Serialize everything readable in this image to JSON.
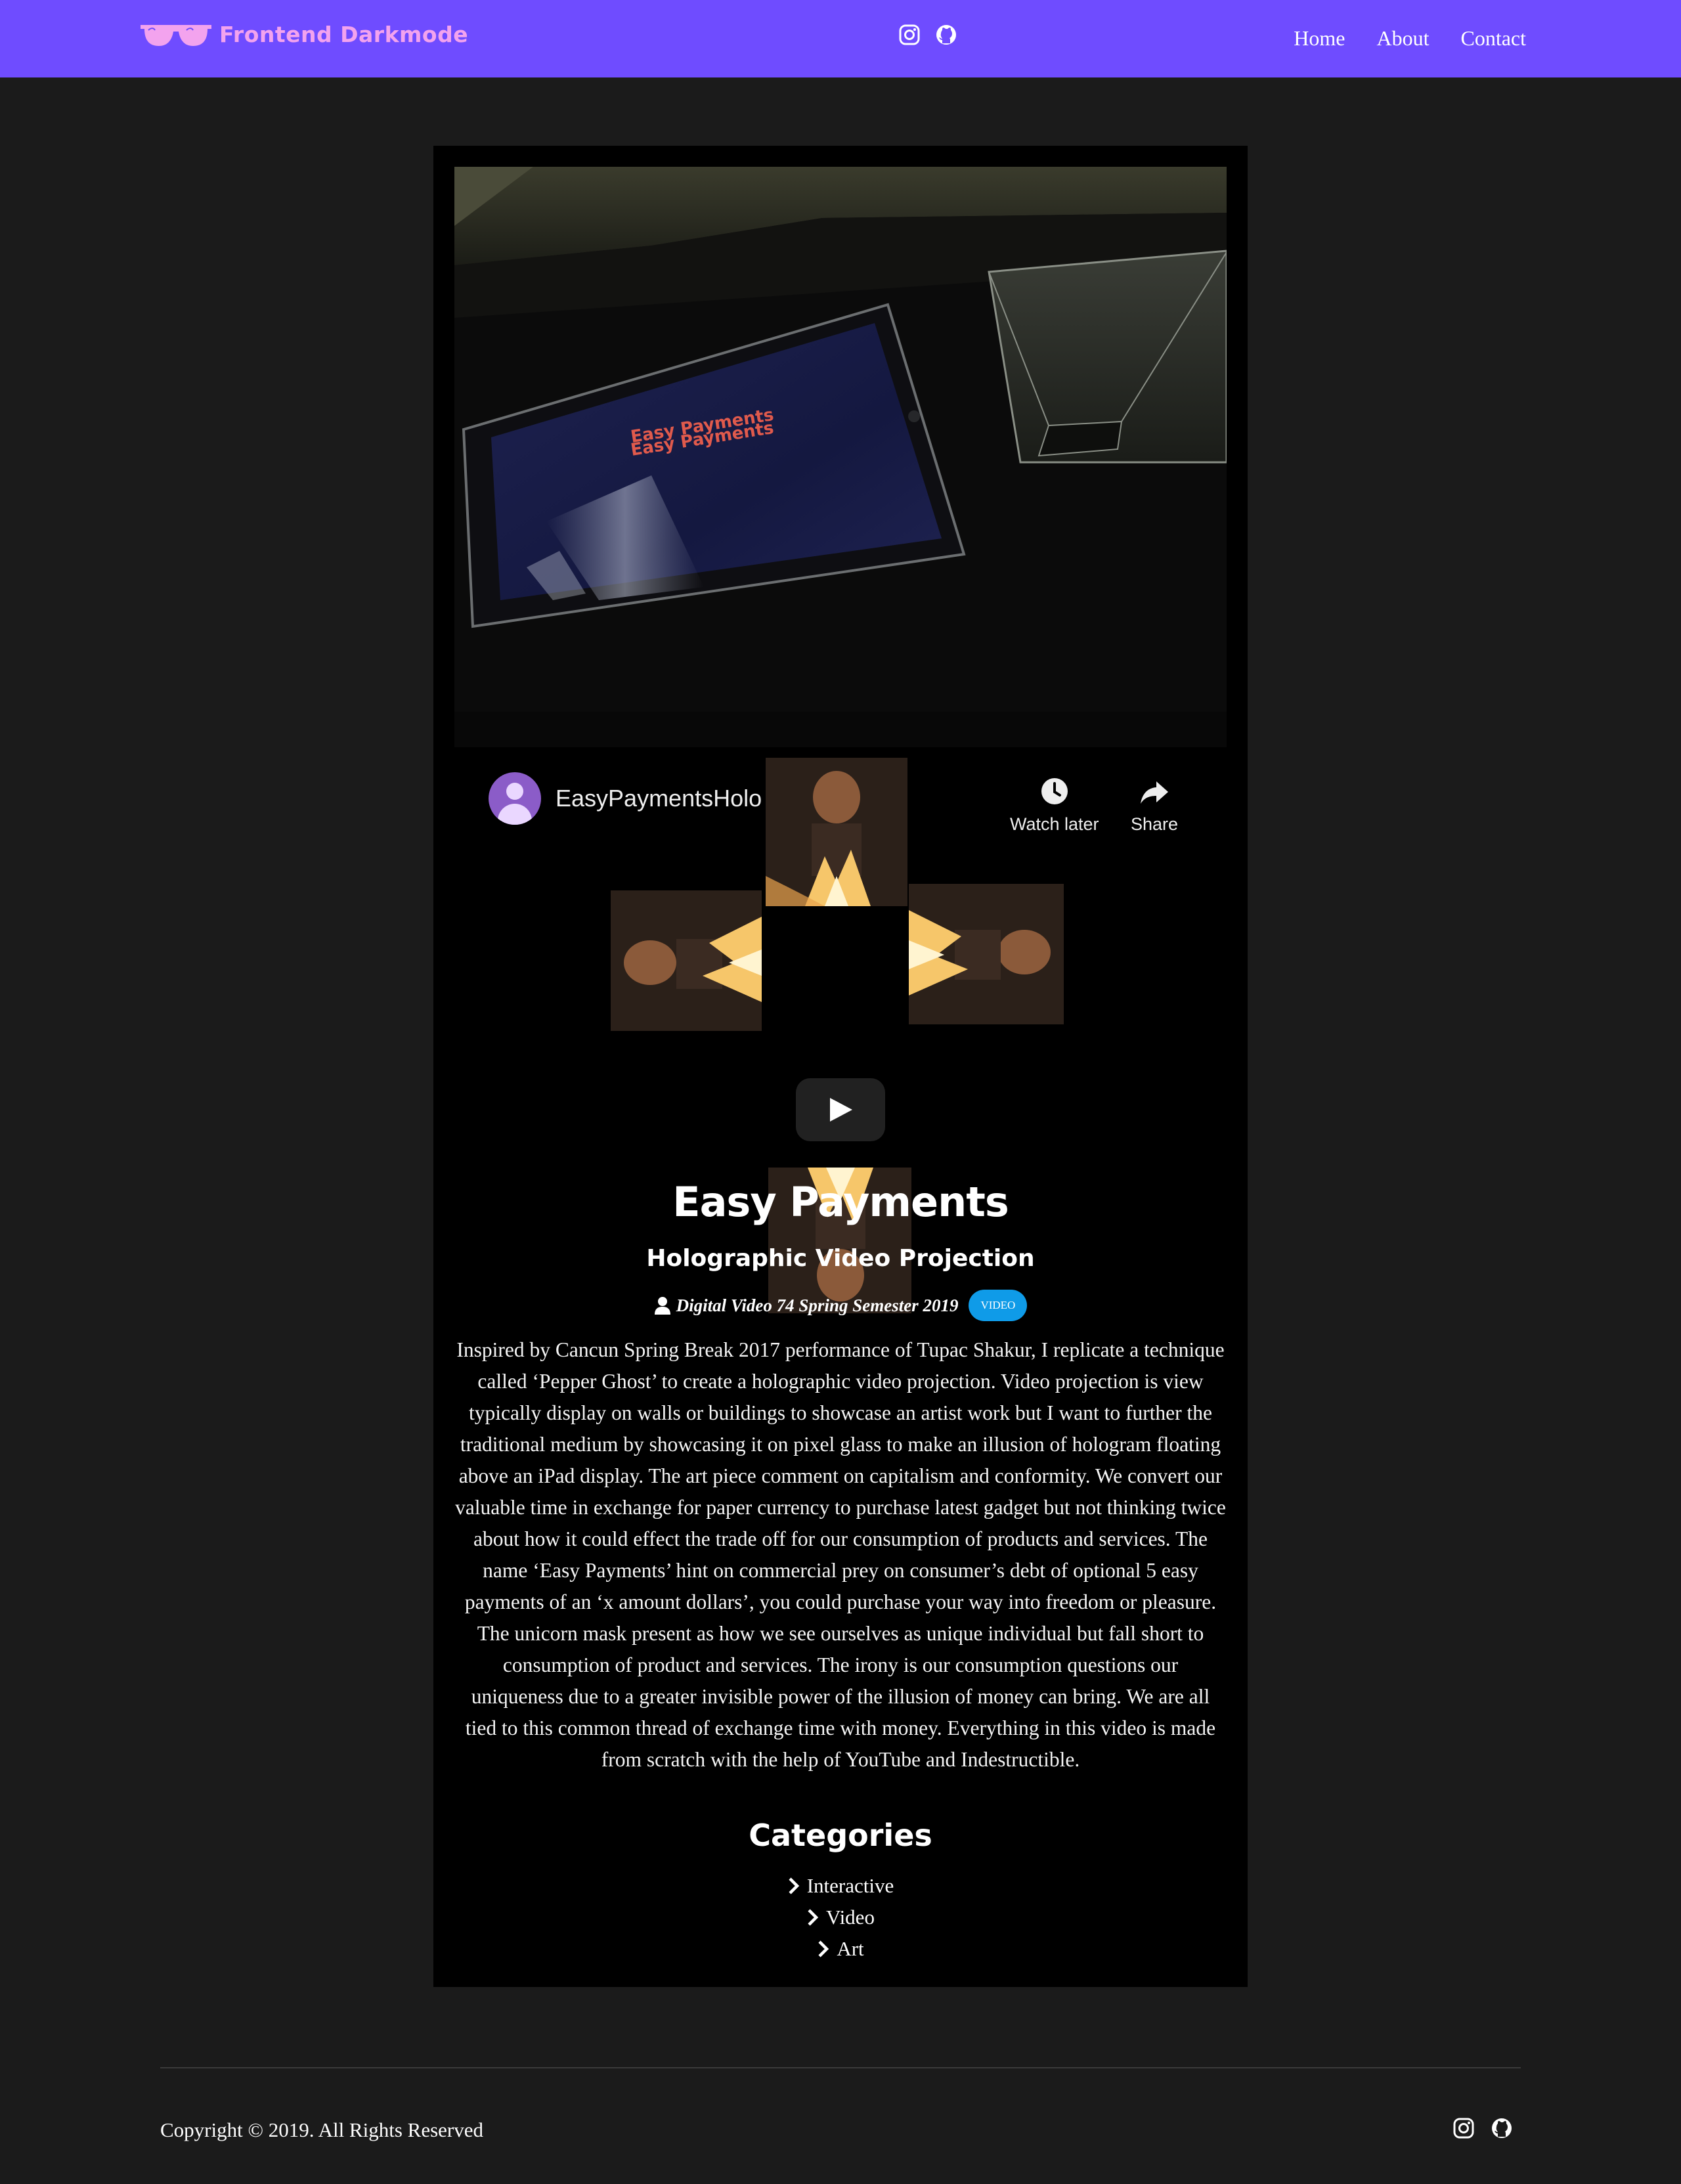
{
  "navbar": {
    "brand": "Frontend Darkmode",
    "brand_color": "#f3a3ee",
    "background": "#6f4cff",
    "social_icons": [
      "instagram-icon",
      "github-icon"
    ],
    "links": [
      "Home",
      "About",
      "Contact"
    ]
  },
  "video": {
    "channel": "EasyPaymentsHolo",
    "watch_later": "Watch later",
    "share": "Share"
  },
  "post": {
    "title": "Easy Payments",
    "subtitle": "Holographic Video Projection",
    "meta": "Digital Video 74 Spring Semester 2019",
    "badge": "VIDEO",
    "badge_color": "#0f9be8",
    "description": "Inspired by Cancun Spring Break 2017 performance of Tupac Shakur, I replicate a technique called ‘Pepper Ghost’ to create a holographic video projection. Video projection is view typically display on walls or buildings to showcase an artist work but I want to further the traditional medium by showcasing it on pixel glass to make an illusion of hologram floating above an iPad display. The art piece comment on capitalism and conformity. We convert our valuable time in exchange for paper currency to purchase latest gadget but not thinking twice about how it could effect the trade off for our consumption of products and services. The name ‘Easy Payments’ hint on commercial prey on consumer’s debt of optional 5 easy payments of an ‘x amount dollars’, you could purchase your way into freedom or pleasure. The unicorn mask present as how we see ourselves as unique individual but fall short to consumption of product and services. The irony is our consumption questions our uniqueness due to a greater invisible power of the illusion of money can bring. We are all tied to this common thread of exchange time with money. Everything in this video is made from scratch with the help of YouTube and Indestructible."
  },
  "photo": {
    "screen_text_1": "Easy Payments",
    "screen_text_2": "Easy Payments"
  },
  "categories": {
    "heading": "Categories",
    "items": [
      "Interactive",
      "Video",
      "Art"
    ]
  },
  "footer": {
    "copyright": "Copyright © 2019. All Rights Reserved",
    "social_icons": [
      "instagram-icon",
      "github-icon"
    ]
  }
}
